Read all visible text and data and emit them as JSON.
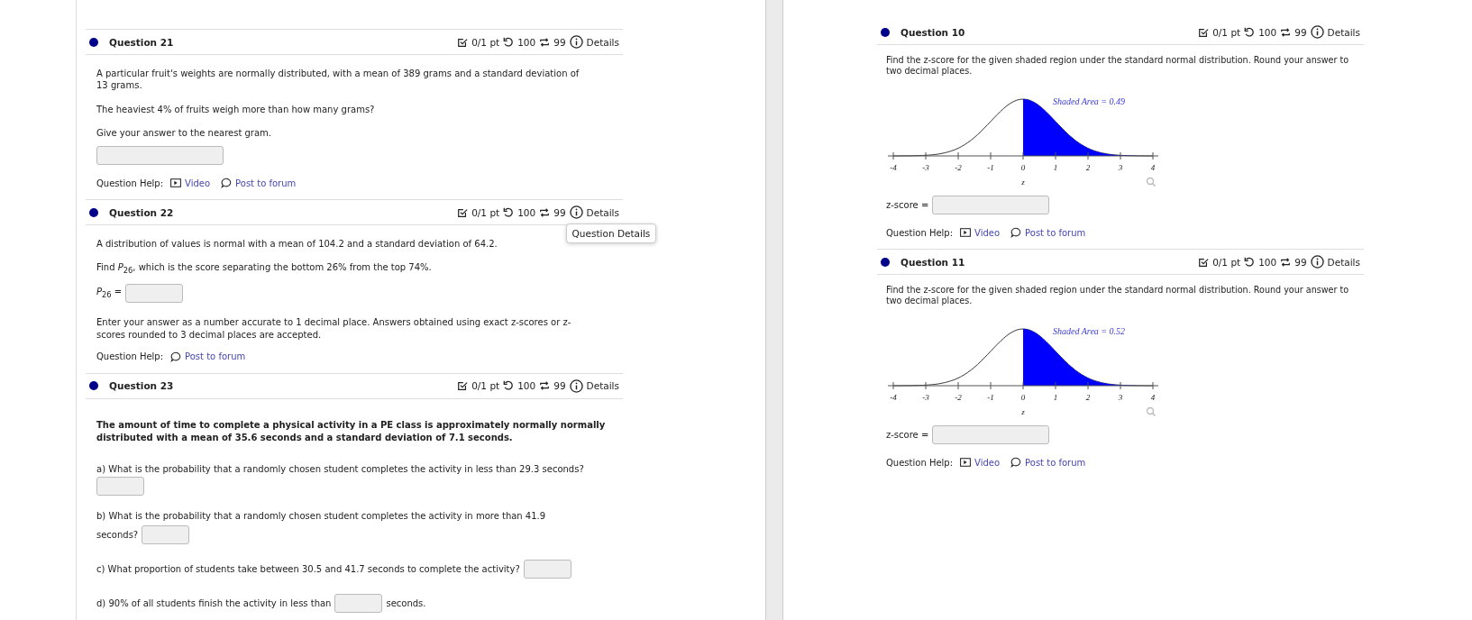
{
  "left": {
    "questions": [
      {
        "title": "Question 21",
        "score": "0/1 pt",
        "tries": "100",
        "retries": "99",
        "details": "Details",
        "body": [
          {
            "kind": "text",
            "parts": [
              {
                "kind": "text",
                "text": "A particular fruit's weights are normally distributed, with a mean of 389 grams and a standard deviation of 13 grams."
              }
            ]
          },
          {
            "kind": "text",
            "parts": [
              {
                "kind": "text",
                "text": "The heaviest 4% of fruits weigh more than how many grams?"
              }
            ]
          },
          {
            "kind": "text",
            "parts": [
              {
                "kind": "text",
                "text": "Give your answer to the nearest gram."
              }
            ]
          },
          {
            "kind": "tight",
            "parts": [
              {
                "kind": "field"
              }
            ]
          }
        ],
        "help": {
          "label": "Question Help:",
          "links": [
            {
              "kind": "video",
              "text": "Video"
            },
            {
              "kind": "forum",
              "text": "Post to forum"
            }
          ]
        }
      },
      {
        "title": "Question 22",
        "score": "0/1 pt",
        "tries": "100",
        "retries": "99",
        "details": "Details",
        "tooltip": "Question Details",
        "body": [
          {
            "kind": "text",
            "parts": [
              {
                "kind": "text",
                "text": "A distribution of values is normal with a mean of 104.2 and a standard deviation of 64.2."
              }
            ]
          },
          {
            "kind": "text",
            "parts": [
              {
                "kind": "text",
                "text": "Find *P*$_{26}$, which is the score separating the bottom 26% from the top 74%."
              }
            ]
          },
          {
            "kind": "tight",
            "parts": [
              {
                "kind": "text",
                "text": "*P*$_{26}$ ="
              },
              {
                "kind": "field"
              }
            ]
          },
          {
            "kind": "text",
            "parts": [
              {
                "kind": "text",
                "text": "Enter your answer as a number accurate to 1 decimal place. Answers obtained using exact z-scores or z-scores rounded to 3 decimal places are accepted."
              }
            ]
          }
        ],
        "help": {
          "label": "Question Help:",
          "links": [
            {
              "kind": "forum",
              "text": "Post to forum"
            }
          ]
        }
      },
      {
        "title": "Question 23",
        "score": "0/1 pt",
        "tries": "100",
        "retries": "99",
        "details": "Details",
        "body": [
          {
            "kind": "strong",
            "parts": [
              {
                "kind": "text",
                "text": "The amount of time to complete a physical activity in a PE class is approximately normally normally distributed with a mean of 35.6 seconds and a standard deviation of 7.1 seconds."
              }
            ]
          },
          {
            "kind": "text",
            "parts": [
              {
                "kind": "text",
                "text": "a) What is the probability that a randomly chosen student completes the activity in less than 29.3 seconds?"
              },
              {
                "kind": "field"
              }
            ]
          },
          {
            "kind": "text",
            "parts": [
              {
                "kind": "text",
                "text": "b) What is the probability that a randomly chosen student completes the activity in more than 41.9"
              }
            ]
          },
          {
            "kind": "cont",
            "parts": [
              {
                "kind": "text",
                "text": "seconds?"
              },
              {
                "kind": "field"
              }
            ]
          },
          {
            "kind": "text",
            "parts": [
              {
                "kind": "text",
                "text": "c) What proportion of students take between 30.5 and 41.7 seconds to complete the activity?"
              },
              {
                "kind": "field"
              }
            ]
          },
          {
            "kind": "text",
            "parts": [
              {
                "kind": "text",
                "text": "d) 90% of all students finish the activity in less than"
              },
              {
                "kind": "field"
              },
              {
                "kind": "text",
                "text": "seconds."
              }
            ]
          }
        ]
      }
    ]
  },
  "right": {
    "questions": [
      {
        "title": "Question 10",
        "score": "0/1 pt",
        "tries": "100",
        "retries": "99",
        "details": "Details",
        "prompt": "Find the z-score for the given shaded region under the standard normal distribution. Round your answer to two decimal places.",
        "figure": {
          "area_label": "Shaded Area = 0.49",
          "tick_labels": [
            "-4",
            "-3",
            "-2",
            "-1",
            "0",
            "1",
            "2",
            "3",
            "4"
          ],
          "axis_label": "z"
        },
        "answer_label": "z-score =",
        "help": {
          "label": "Question Help:",
          "links": [
            {
              "kind": "video",
              "text": "Video"
            },
            {
              "kind": "forum",
              "text": "Post to forum"
            }
          ]
        }
      },
      {
        "title": "Question 11",
        "score": "0/1 pt",
        "tries": "100",
        "retries": "99",
        "details": "Details",
        "prompt": "Find the z-score for the given shaded region under the standard normal distribution. Round your answer to two decimal places.",
        "figure": {
          "area_label": "Shaded Area = 0.52",
          "tick_labels": [
            "-4",
            "-3",
            "-2",
            "-1",
            "0",
            "1",
            "2",
            "3",
            "4"
          ],
          "axis_label": "z"
        },
        "answer_label": "z-score =",
        "help": {
          "label": "Question Help:",
          "links": [
            {
              "kind": "video",
              "text": "Video"
            },
            {
              "kind": "forum",
              "text": "Post to forum"
            }
          ]
        }
      }
    ]
  }
}
